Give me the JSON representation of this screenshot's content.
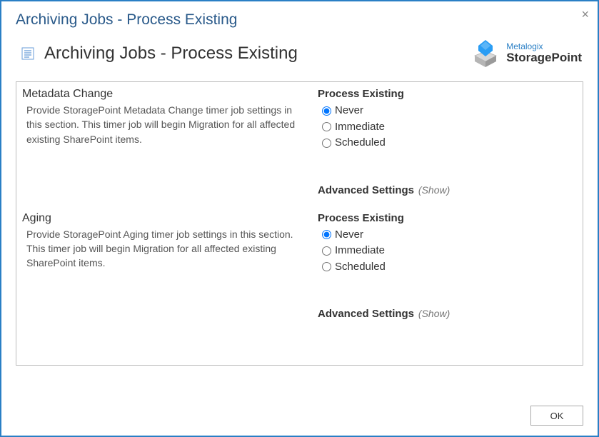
{
  "dialog": {
    "title": "Archiving Jobs - Process Existing",
    "close_glyph": "×"
  },
  "header": {
    "page_title": "Archiving Jobs - Process Existing",
    "brand_line1": "Metalogix",
    "brand_line2": "StoragePoint"
  },
  "sections": [
    {
      "heading": "Metadata Change",
      "desc": "Provide StoragePoint Metadata Change timer job settings in this section.\nThis timer job will begin Migration for all affected existing SharePoint items.",
      "process_label": "Process Existing",
      "options": [
        "Never",
        "Immediate",
        "Scheduled"
      ],
      "selected": "Never",
      "adv_label": "Advanced Settings",
      "adv_toggle": "(Show)"
    },
    {
      "heading": "Aging",
      "desc": "Provide StoragePoint Aging timer job settings in this section.\nThis timer job will begin Migration for all affected existing SharePoint items.",
      "process_label": "Process Existing",
      "options": [
        "Never",
        "Immediate",
        "Scheduled"
      ],
      "selected": "Never",
      "adv_label": "Advanced Settings",
      "adv_toggle": "(Show)"
    }
  ],
  "footer": {
    "ok_label": "OK"
  }
}
